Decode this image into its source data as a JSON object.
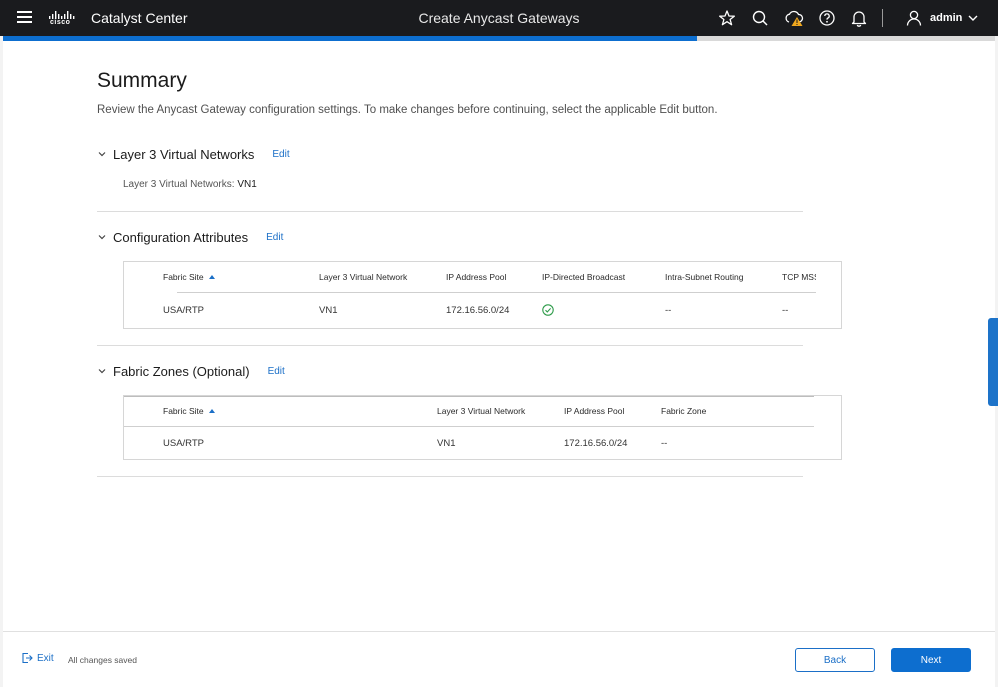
{
  "header": {
    "app_title": "Catalyst Center",
    "logo_text": "cisco",
    "page_title": "Create Anycast Gateways",
    "user": "admin",
    "icons": [
      "menu-icon",
      "star-icon",
      "search-icon",
      "cloud-alert-icon",
      "help-icon",
      "bell-icon",
      "user-icon",
      "chevron-down-icon"
    ]
  },
  "progress": {
    "fraction": 0.7
  },
  "summary": {
    "title": "Summary",
    "subtitle": "Review the Anycast Gateway configuration settings. To make changes before continuing, select the applicable Edit button."
  },
  "sections": {
    "vn": {
      "title": "Layer 3 Virtual Networks",
      "edit": "Edit",
      "label": "Layer 3 Virtual Networks:",
      "value": "VN1"
    },
    "config": {
      "title": "Configuration Attributes",
      "edit": "Edit",
      "columns": [
        "Fabric Site",
        "Layer 3 Virtual Network",
        "IP Address Pool",
        "IP-Directed Broadcast",
        "Intra-Subnet Routing",
        "TCP MSS"
      ],
      "row": {
        "site": "USA/RTP",
        "vn": "VN1",
        "pool": "172.16.56.0/24",
        "broadcast_icon": "check-circle-icon",
        "intra": "--",
        "tcp": "--"
      }
    },
    "zones": {
      "title": "Fabric Zones (Optional)",
      "edit": "Edit",
      "columns": [
        "Fabric Site",
        "Layer 3 Virtual Network",
        "IP Address Pool",
        "Fabric Zone"
      ],
      "row": {
        "site": "USA/RTP",
        "vn": "VN1",
        "pool": "172.16.56.0/24",
        "zone": "--"
      }
    }
  },
  "footer": {
    "exit": "Exit",
    "status": "All changes saved",
    "back": "Back",
    "next": "Next"
  },
  "colors": {
    "accent": "#0d6ecf",
    "topbar": "#1a1b1e",
    "success": "#2e9b4a",
    "warning": "#f0a81e"
  }
}
